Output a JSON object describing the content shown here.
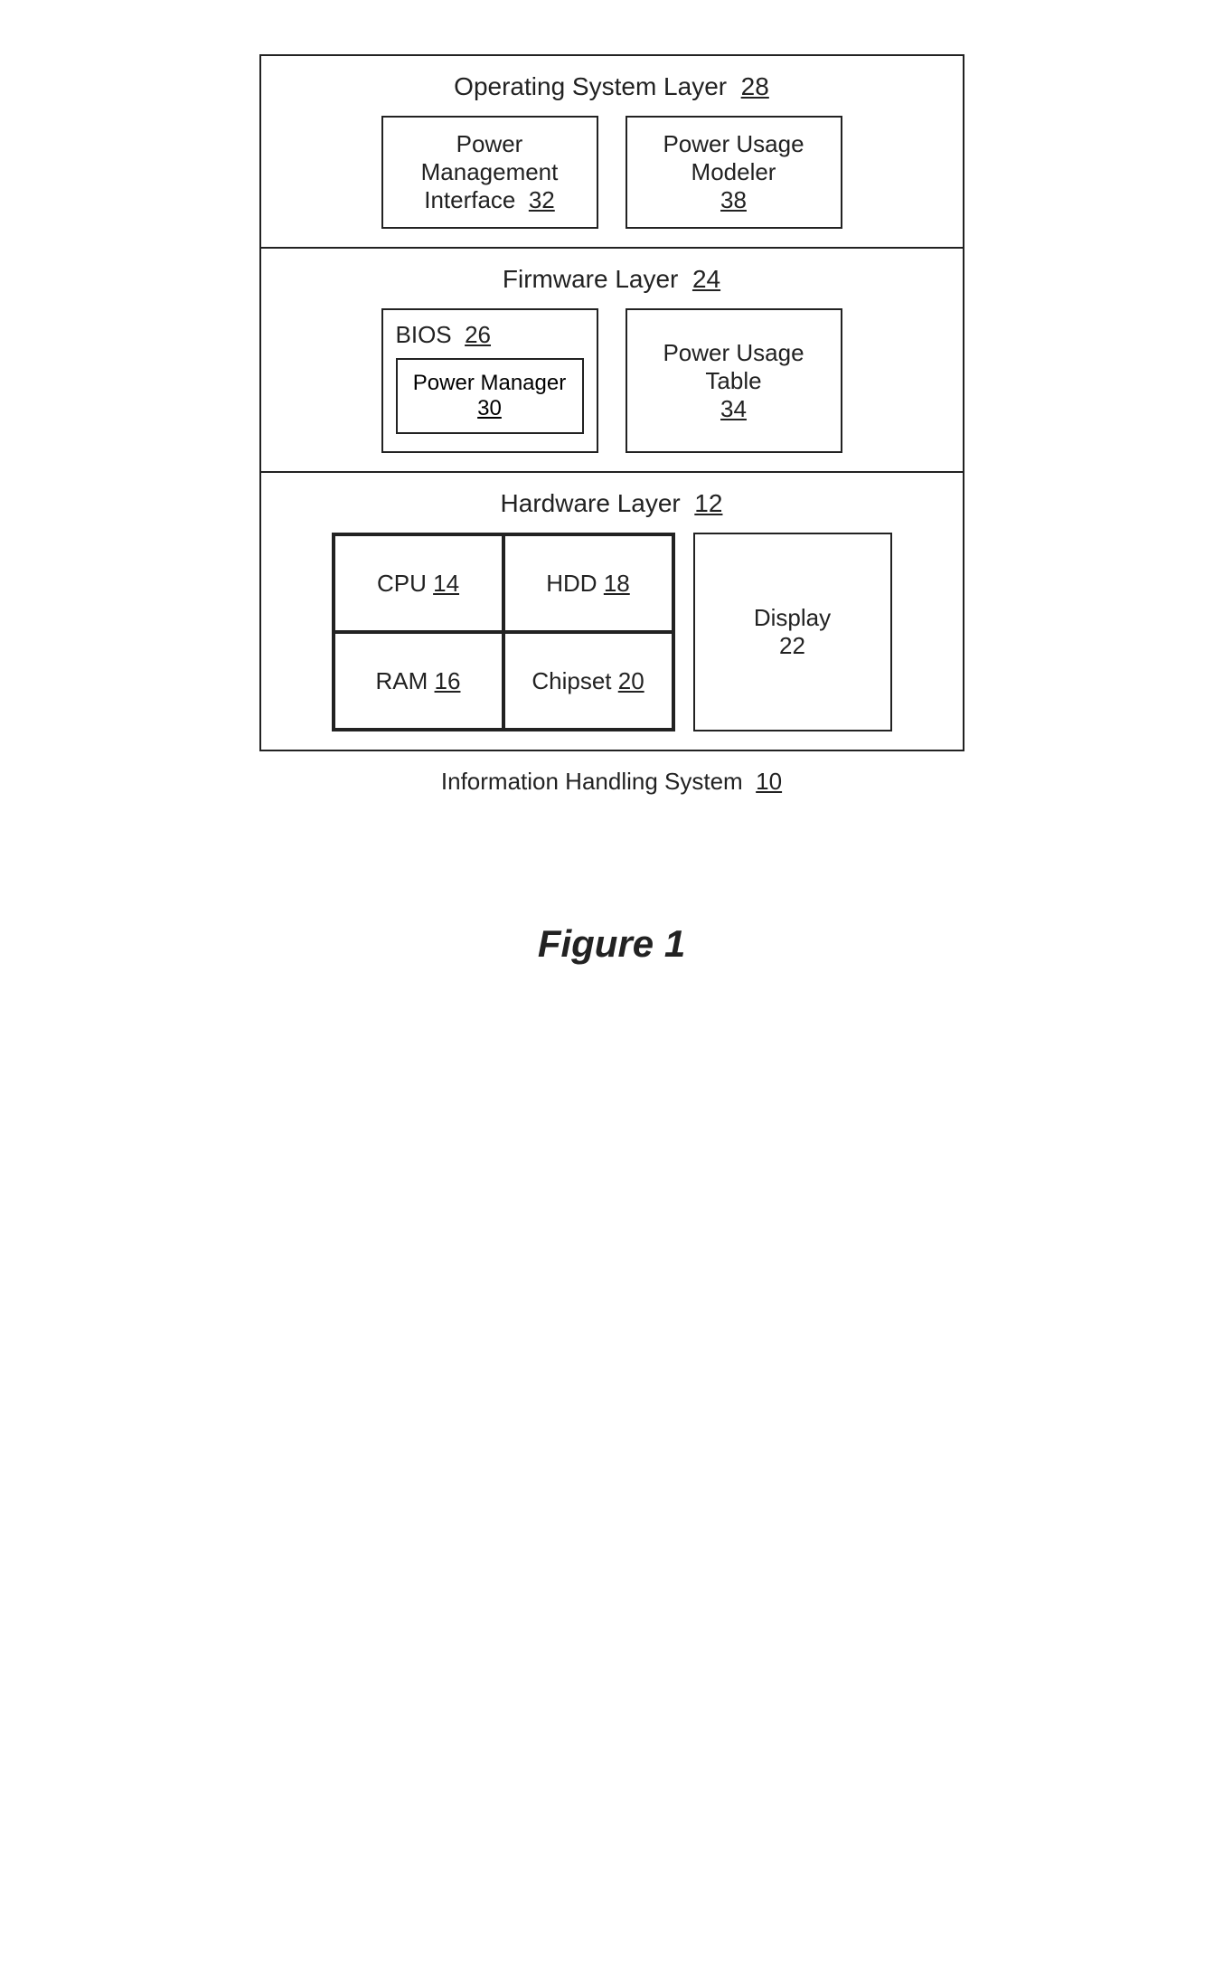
{
  "os_layer": {
    "title": "Operating System Layer",
    "title_num": "28",
    "left_box": {
      "label": "Power Management Interface",
      "num": "32"
    },
    "right_box": {
      "label": "Power Usage Modeler",
      "num": "38"
    }
  },
  "firmware_layer": {
    "title": "Firmware Layer",
    "title_num": "24",
    "bios": {
      "label": "BIOS",
      "num": "26",
      "inner": {
        "label": "Power Manager",
        "num": "30"
      }
    },
    "right_box": {
      "label": "Power Usage Table",
      "num": "34"
    }
  },
  "hardware_layer": {
    "title": "Hardware Layer",
    "title_num": "12",
    "cpu": {
      "label": "CPU",
      "num": "14"
    },
    "hdd": {
      "label": "HDD",
      "num": "18"
    },
    "ram": {
      "label": "RAM",
      "num": "16"
    },
    "chipset": {
      "label": "Chipset",
      "num": "20"
    },
    "display": {
      "label": "Display",
      "num": "22"
    }
  },
  "system_label": {
    "text": "Information Handling System",
    "num": "10"
  },
  "figure": {
    "label": "Figure 1"
  }
}
